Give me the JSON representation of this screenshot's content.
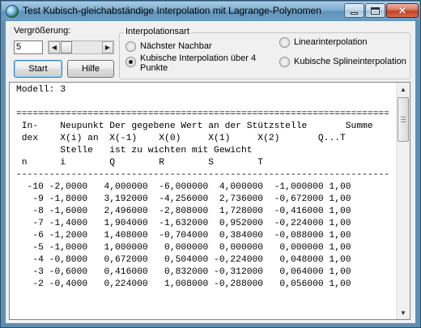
{
  "window": {
    "title": "Test Kubisch-gleichabständige Interpolation mit Lagrange-Polynomen",
    "icon": "globe-icon",
    "close_glyph": "×"
  },
  "controls": {
    "zoom_label": "Vergrößerung:",
    "zoom_value": "5",
    "start_label": "Start",
    "help_label": "Hilfe"
  },
  "interpolation": {
    "group_title": "Interpolationsart",
    "options": [
      {
        "label": "Nächster Nachbar",
        "checked": false
      },
      {
        "label": "Kubische Interpolation über 4 Punkte",
        "checked": true
      },
      {
        "label": "Linearinterpolation",
        "checked": false
      },
      {
        "label": "Kubische Splineinterpolation",
        "checked": false
      }
    ]
  },
  "output": {
    "lines": [
      "Modell: 3",
      "",
      "====================================================================",
      " In-    Neupunkt Der gegebene Wert an der Stützstelle       Summe",
      " dex    X(i) an  X(-1)    X(0)     X(1)     X(2)       Q...T",
      "        Stelle   ist zu wichten mit Gewicht",
      " n      i        Q        R        S        T",
      "--------------------------------------------------------------------",
      "  -10 -2,0000   4,000000  -6,000000  4,000000  -1,000000 1,00",
      "   -9 -1,8000   3,192000  -4,256000  2,736000  -0,672000 1,00",
      "   -8 -1,6000   2,496000  -2,808000  1,728000  -0,416000 1,00",
      "   -7 -1,4000   1,904000  -1,632000  0,952000  -0,224000 1,00",
      "   -6 -1,2000   1,408000  -0,704000  0,384000  -0,088000 1,00",
      "   -5 -1,0000   1,000000   0,000000  0,000000   0,000000 1,00",
      "   -4 -0,8000   0,672000   0,504000 -0,224000   0,048000 1,00",
      "   -3 -0,6000   0,416000   0,832000 -0,312000   0,064000 1,00",
      "   -2 -0,4000   0,224000   1,008000 -0,288000   0,056000 1,00"
    ]
  }
}
